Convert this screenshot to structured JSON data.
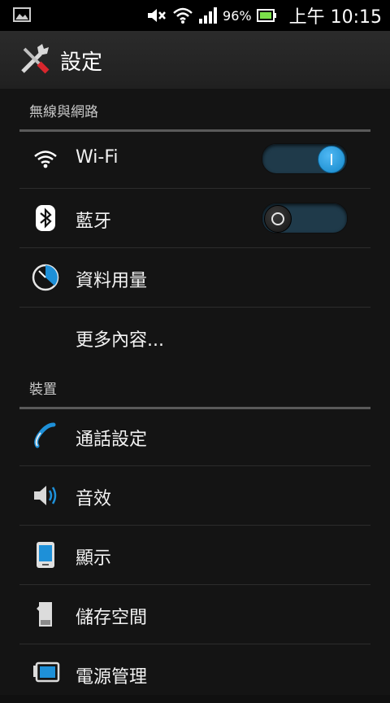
{
  "status_bar": {
    "battery_percent": "96%",
    "time": "上午 10:15",
    "icons": [
      "picture-icon",
      "mute-icon",
      "wifi-icon",
      "signal-icon",
      "battery-icon"
    ]
  },
  "action_bar": {
    "title": "設定",
    "icon": "tools-icon"
  },
  "sections": {
    "wireless": {
      "title": "無線與網路",
      "wifi": {
        "label": "Wi-Fi",
        "state": "on"
      },
      "bluetooth": {
        "label": "藍牙",
        "state": "off"
      },
      "data_usage": {
        "label": "資料用量"
      },
      "more": {
        "label": "更多內容..."
      }
    },
    "device": {
      "title": "裝置",
      "call_settings": {
        "label": "通話設定"
      },
      "sound": {
        "label": "音效"
      },
      "display": {
        "label": "顯示"
      },
      "storage": {
        "label": "儲存空間"
      },
      "power": {
        "label": "電源管理"
      }
    }
  },
  "colors": {
    "accent": "#1e90d8",
    "toggle_track": "#1f3a4a",
    "background": "#141414"
  }
}
